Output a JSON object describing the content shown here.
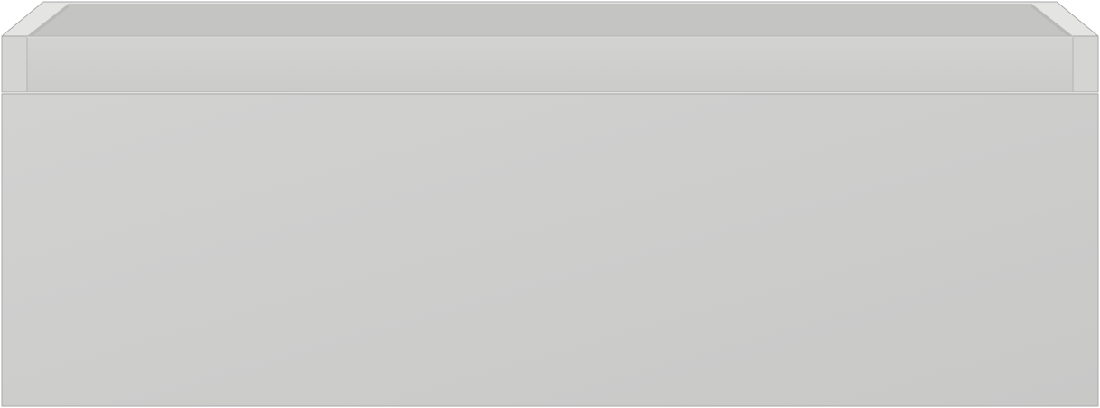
{
  "image": {
    "subject": "drawer-unit-render",
    "background_color": "#ffffff",
    "colors": {
      "inner_back_wall": "#c4c4c3",
      "inner_side_wall": "#b9b9b8",
      "rim_top_edge": "#e4e4e3",
      "drawer_box_front": "#d0d0cf",
      "side_post": "#d4d4d3",
      "front_panel_light": "#d2d2d1",
      "front_panel_dark": "#c8c8c7",
      "outline": "#a9a9a8"
    }
  }
}
